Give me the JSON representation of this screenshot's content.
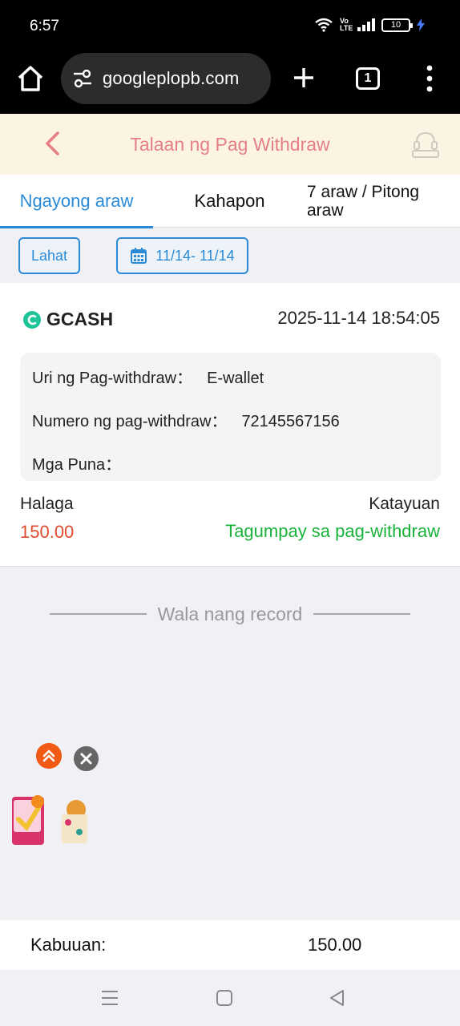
{
  "status_bar": {
    "time": "6:57",
    "network": "Vo LTE",
    "battery": "10"
  },
  "browser": {
    "url": "googleplopb.com",
    "tab_count": "1"
  },
  "header": {
    "title": "Talaan ng Pag Withdraw"
  },
  "tabs": [
    {
      "label": "Ngayong araw",
      "active": true
    },
    {
      "label": "Kahapon",
      "active": false
    },
    {
      "label": "7 araw / Pitong araw",
      "active": false
    }
  ],
  "filters": {
    "type_label": "Lahat",
    "date_range": "11/14- 11/14"
  },
  "record": {
    "method": "GCASH",
    "datetime": "2025-11-14 18:54:05",
    "type_label": "Uri ng Pag-withdraw：",
    "type_value": "E-wallet",
    "number_label": "Numero ng pag-withdraw：",
    "number_value": "72145567156",
    "remarks_label": "Mga Puna：",
    "remarks_value": "",
    "amount_label": "Halaga",
    "amount_value": "150.00",
    "status_label": "Katayuan",
    "status_value": "Tagumpay sa pag-withdraw"
  },
  "no_more_text": "Wala nang record",
  "totals": {
    "label": "Kabuuan:",
    "value": "150.00"
  },
  "colors": {
    "accent": "#2b8ad6",
    "title": "#e67f86",
    "amount": "#e04b2c",
    "success": "#19b33c"
  }
}
